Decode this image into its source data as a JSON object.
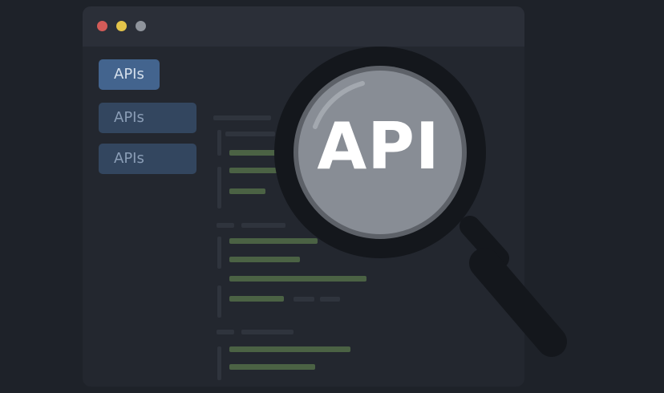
{
  "sidebar": {
    "items": [
      {
        "label": "APIs",
        "active": true
      },
      {
        "label": "APIs",
        "active": false
      },
      {
        "label": "APIs",
        "active": false
      }
    ]
  },
  "lens": {
    "text": "API"
  },
  "colors": {
    "background": "#1e2229",
    "window": "#23272f",
    "titlebar": "#2b2f38",
    "active_button": "#43648e",
    "button": "#33465f",
    "code_green": "#4b6244",
    "lens_glass": "#888d95",
    "lens_rim": "#14171c"
  },
  "icons": {
    "window_controls": [
      "close-dot",
      "minimize-dot",
      "maximize-dot"
    ],
    "overlay": "magnifying-glass-icon"
  }
}
